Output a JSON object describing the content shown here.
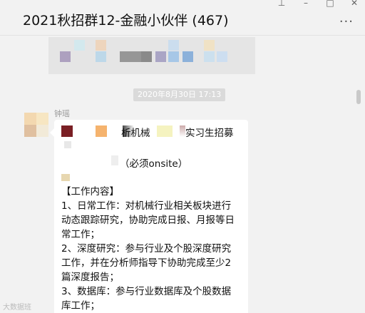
{
  "header": {
    "title": "2021秋招群12-金融小伙伴 (467)",
    "more_icon": "more-dots-icon",
    "window_controls": [
      "pin-icon",
      "minimize-icon",
      "maximize-icon",
      "close-icon"
    ]
  },
  "conversation": {
    "timestamp": "2020年8月30日 17:13",
    "sender_name": "钟瑶",
    "message": {
      "lines": [
        "析机械",
        "实习生招募",
        "（必须onsite）",
        "【工作内容】",
        "1、日常工作：对机械行业相关板块进行",
        "动态跟踪研究，协助完成日报、月报等日",
        "常工作；",
        "2、深度研究：参与行业及个股深度研究",
        "工作，并在分析师指导下协助完成至少2",
        "篇深度报告；",
        "3、数据库：参与行业数据库及个股数据",
        "库工作；"
      ]
    }
  },
  "watermark": "大数据班",
  "colors": {
    "background": "#f2f2f2",
    "bubble": "#ffffff",
    "timestamp_bg": "#dadada"
  }
}
